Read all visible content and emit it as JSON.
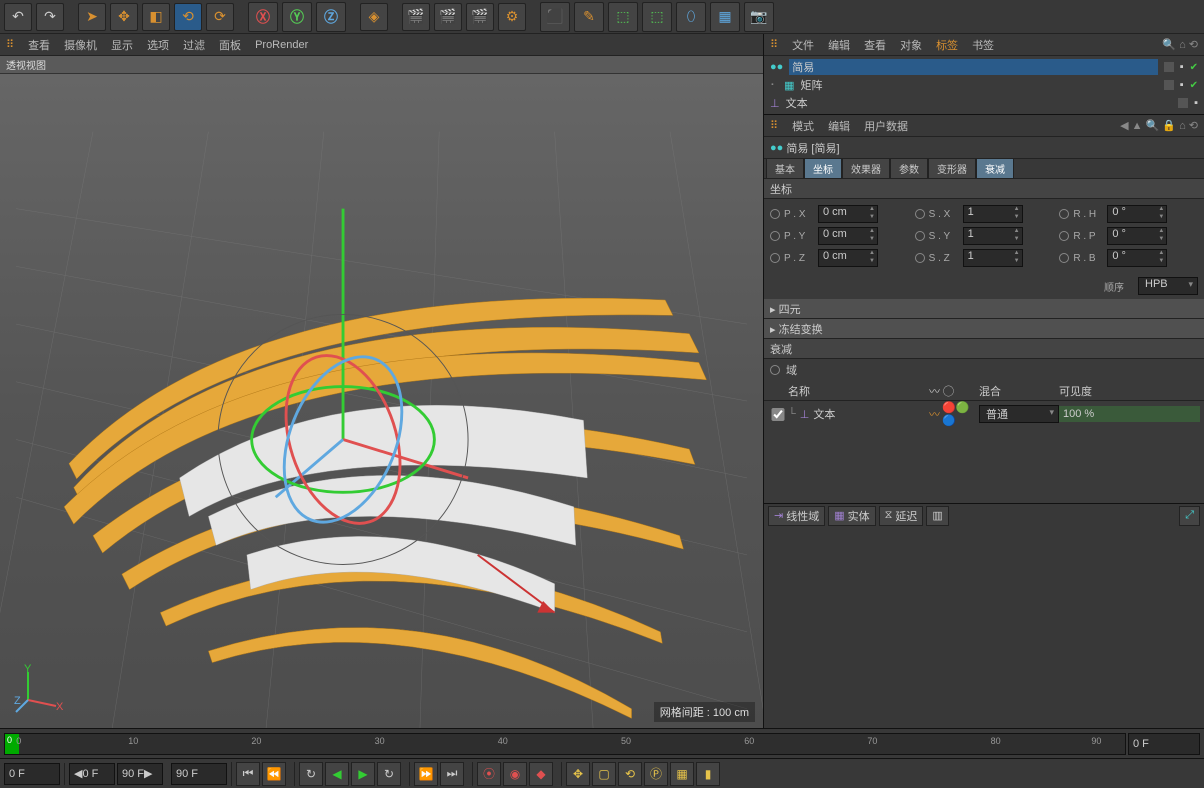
{
  "toolbar_icons": [
    "cursor",
    "move",
    "scale",
    "rotate-sel",
    "rotate",
    "axis-x",
    "axis-y",
    "axis-z",
    "cube",
    "clapper",
    "clap2",
    "clap3",
    "gear",
    "prim-cube",
    "pen",
    "def-cube",
    "def-cube2",
    "blob",
    "grid",
    "camera"
  ],
  "vpmenu": {
    "items": [
      "查看",
      "摄像机",
      "显示",
      "选项",
      "过滤",
      "面板",
      "ProRender"
    ],
    "crumb": "透视视图",
    "gridinfo": "网格间距 : 100 cm"
  },
  "obj_menu": {
    "items": [
      "文件",
      "编辑",
      "查看",
      "对象"
    ],
    "hi_items": [
      "标签",
      "书签"
    ]
  },
  "objects": [
    {
      "name": "简易",
      "sel": true,
      "icon": "effector"
    },
    {
      "name": "矩阵",
      "sel": false,
      "icon": "matrix"
    },
    {
      "name": "文本",
      "sel": false,
      "icon": "text"
    }
  ],
  "attr_menu": {
    "items": [
      "模式",
      "编辑",
      "用户数据"
    ]
  },
  "attr_title": "简易 [简易]",
  "tabs": [
    {
      "label": "基本",
      "act": false
    },
    {
      "label": "坐标",
      "act": true
    },
    {
      "label": "效果器",
      "act": false
    },
    {
      "label": "参数",
      "act": false
    },
    {
      "label": "变形器",
      "act": false
    },
    {
      "label": "衰减",
      "act": true
    }
  ],
  "coord_section": "坐标",
  "coords": {
    "px": {
      "label": "P . X",
      "val": "0 cm"
    },
    "py": {
      "label": "P . Y",
      "val": "0 cm"
    },
    "pz": {
      "label": "P . Z",
      "val": "0 cm"
    },
    "sx": {
      "label": "S . X",
      "val": "1"
    },
    "sy": {
      "label": "S . Y",
      "val": "1"
    },
    "sz": {
      "label": "S . Z",
      "val": "1"
    },
    "rh": {
      "label": "R . H",
      "val": "0 °"
    },
    "rp": {
      "label": "R . P",
      "val": "0 °"
    },
    "rb": {
      "label": "R . B",
      "val": "0 °"
    }
  },
  "order": {
    "label": "顺序",
    "value": "HPB"
  },
  "collapsed": [
    "▸ 四元",
    "▸ 冻结变换"
  ],
  "falloff_section": "衰减",
  "field_radio": "域",
  "field_headers": {
    "name": "名称",
    "blend": "混合",
    "vis": "可见度"
  },
  "field_row": {
    "name": "文本",
    "mode": "普通",
    "pct": "100 %"
  },
  "field_toolbar": [
    "线性域",
    "实体",
    "延迟"
  ],
  "timeline": {
    "marks": [
      0,
      10,
      20,
      30,
      40,
      50,
      60,
      70,
      80,
      90
    ],
    "head": "0",
    "end": "0 F"
  },
  "transport": {
    "cur": "0 F",
    "range_a": "0 F",
    "range_b": "90 F",
    "end": "90 F"
  }
}
